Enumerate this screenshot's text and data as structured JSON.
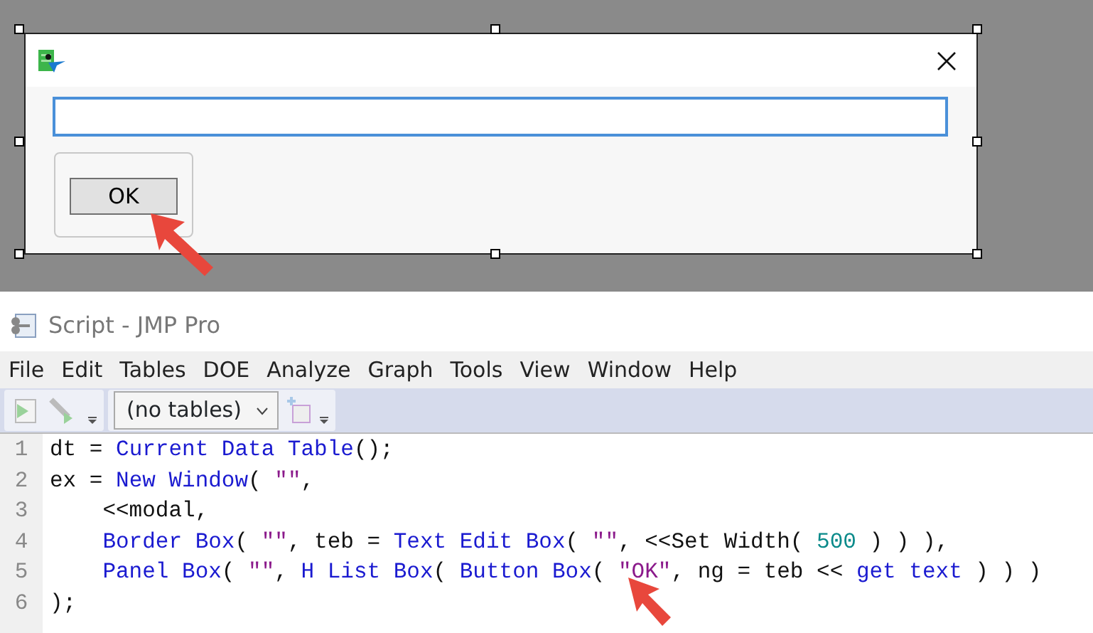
{
  "dialog": {
    "button": "OK"
  },
  "script_window": {
    "title": "Script - JMP Pro",
    "menu": [
      "File",
      "Edit",
      "Tables",
      "DOE",
      "Analyze",
      "Graph",
      "Tools",
      "View",
      "Window",
      "Help"
    ],
    "toolbar": {
      "table_select": "(no tables)"
    },
    "code": [
      {
        "number": "1",
        "tokens": [
          {
            "kind": "plain",
            "text": "dt = "
          },
          {
            "kind": "func",
            "text": "Current Data Table"
          },
          {
            "kind": "plain",
            "text": "();"
          }
        ]
      },
      {
        "number": "2",
        "tokens": [
          {
            "kind": "plain",
            "text": "ex = "
          },
          {
            "kind": "func",
            "text": "New Window"
          },
          {
            "kind": "plain",
            "text": "( "
          },
          {
            "kind": "string",
            "text": "\"\""
          },
          {
            "kind": "plain",
            "text": ","
          }
        ]
      },
      {
        "number": "3",
        "indent": true,
        "tokens": [
          {
            "kind": "plain",
            "text": "<<modal,"
          }
        ]
      },
      {
        "number": "4",
        "indent": true,
        "tokens": [
          {
            "kind": "func",
            "text": "Border Box"
          },
          {
            "kind": "plain",
            "text": "( "
          },
          {
            "kind": "string",
            "text": "\"\""
          },
          {
            "kind": "plain",
            "text": ", teb = "
          },
          {
            "kind": "func",
            "text": "Text Edit Box"
          },
          {
            "kind": "plain",
            "text": "( "
          },
          {
            "kind": "string",
            "text": "\"\""
          },
          {
            "kind": "plain",
            "text": ", <<Set Width( "
          },
          {
            "kind": "number",
            "text": "500"
          },
          {
            "kind": "plain",
            "text": " ) ) ),"
          }
        ]
      },
      {
        "number": "5",
        "indent": true,
        "tokens": [
          {
            "kind": "func",
            "text": "Panel Box"
          },
          {
            "kind": "plain",
            "text": "( "
          },
          {
            "kind": "string",
            "text": "\"\""
          },
          {
            "kind": "plain",
            "text": ", "
          },
          {
            "kind": "func",
            "text": "H List Box"
          },
          {
            "kind": "plain",
            "text": "( "
          },
          {
            "kind": "func",
            "text": "Button Box"
          },
          {
            "kind": "plain",
            "text": "( "
          },
          {
            "kind": "string",
            "text": "\"OK\""
          },
          {
            "kind": "plain",
            "text": ", ng = teb << "
          },
          {
            "kind": "func",
            "text": "get text"
          },
          {
            "kind": "plain",
            "text": " ) ) )"
          }
        ]
      },
      {
        "number": "6",
        "tokens": [
          {
            "kind": "plain",
            "text": ");"
          }
        ]
      }
    ]
  }
}
